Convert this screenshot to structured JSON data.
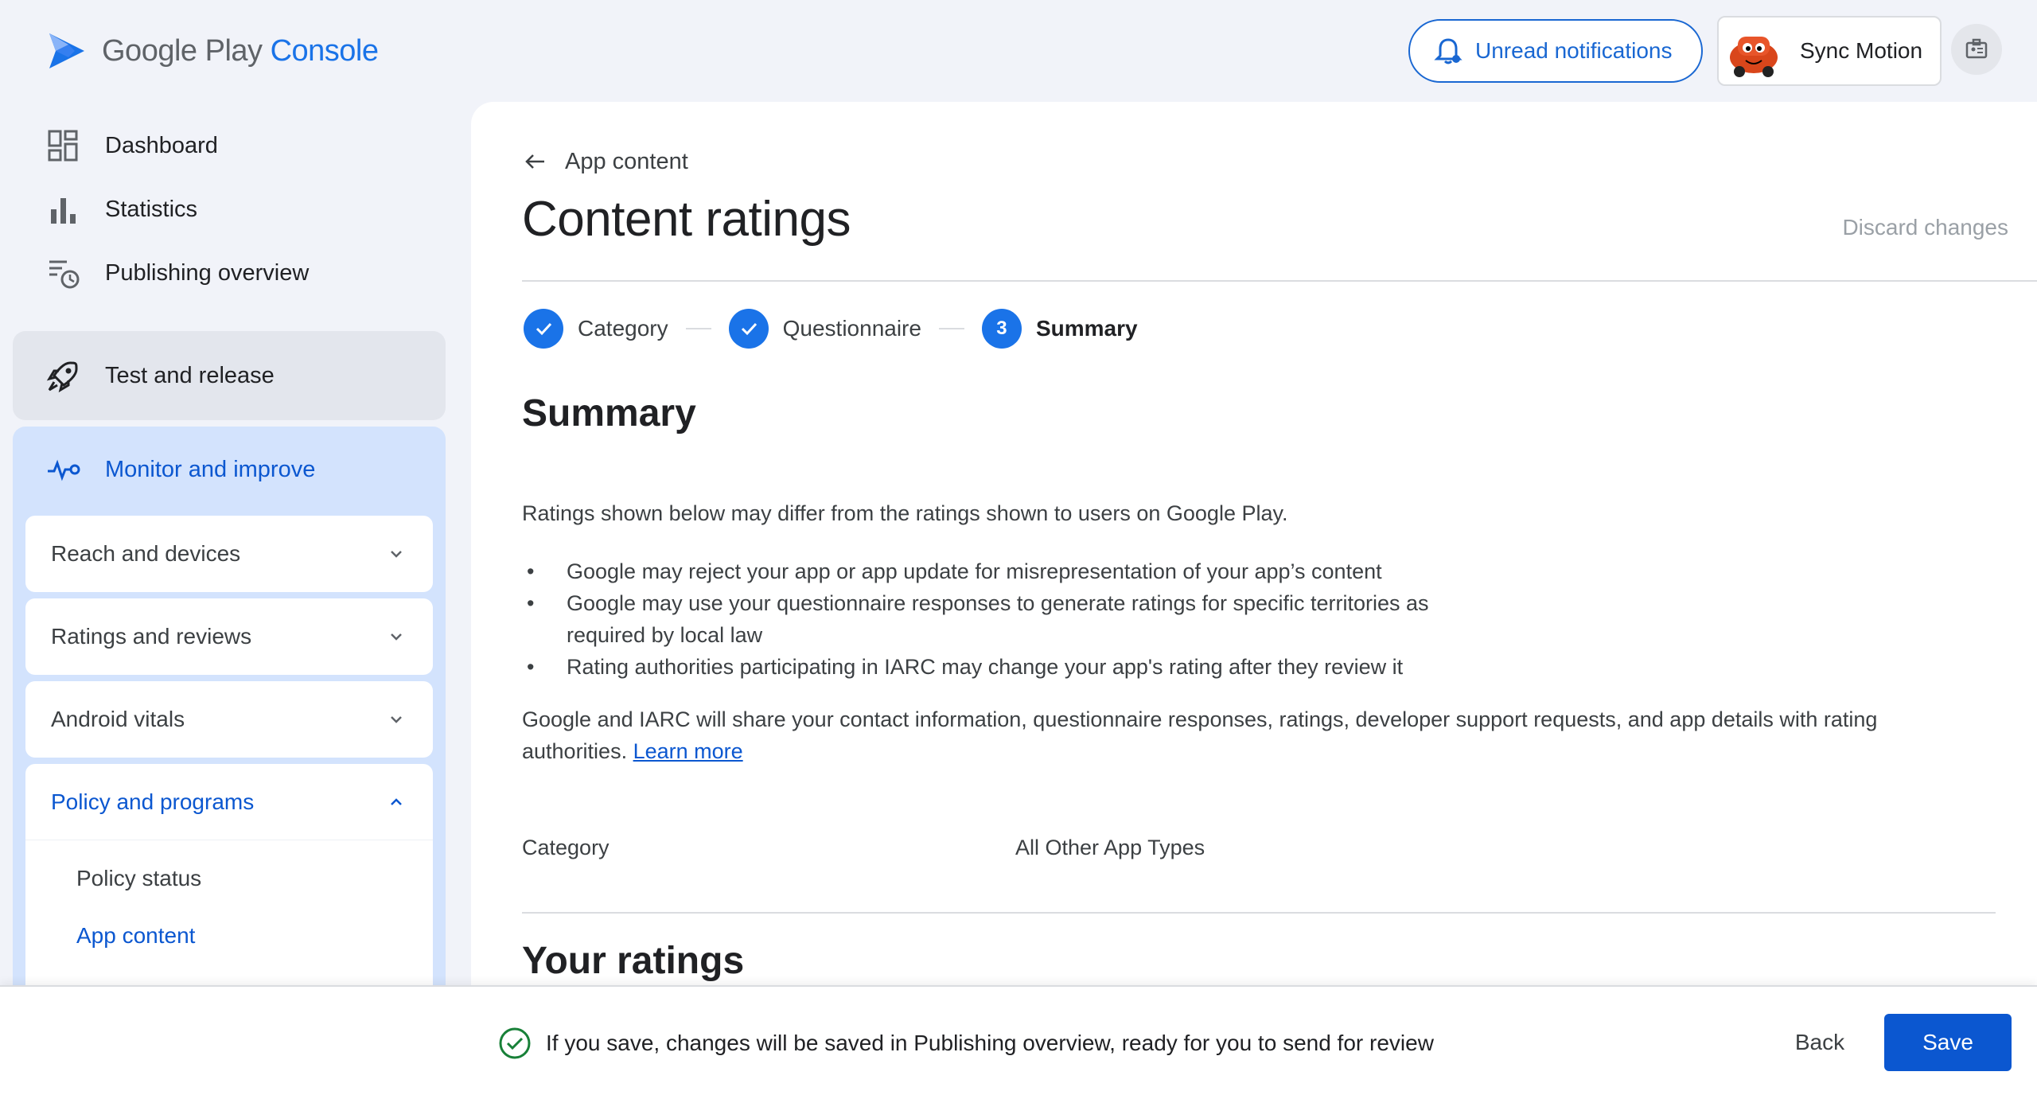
{
  "header": {
    "logo_google_play": "Google Play",
    "logo_console": "Console",
    "notifications_label": "Unread notifications",
    "account_name": "Sync Motion"
  },
  "sidebar": {
    "items": [
      {
        "label": "Dashboard",
        "icon": "dashboard-icon"
      },
      {
        "label": "Statistics",
        "icon": "bar-chart-icon"
      },
      {
        "label": "Publishing overview",
        "icon": "publishing-overview-icon"
      }
    ],
    "test_and_release": "Test and release",
    "monitor_and_improve": "Monitor and improve",
    "groups": [
      {
        "label": "Reach and devices",
        "expanded": false
      },
      {
        "label": "Ratings and reviews",
        "expanded": false
      },
      {
        "label": "Android vitals",
        "expanded": false
      }
    ],
    "policy_group": {
      "label": "Policy and programs",
      "expanded": true,
      "sub_items": [
        {
          "label": "Policy status",
          "active": false
        },
        {
          "label": "App content",
          "active": true
        }
      ]
    }
  },
  "main": {
    "back_label": "App content",
    "title": "Content ratings",
    "discard_label": "Discard changes",
    "steps": [
      {
        "label": "Category",
        "state": "done"
      },
      {
        "label": "Questionnaire",
        "state": "done"
      },
      {
        "label": "Summary",
        "state": "current",
        "number": "3"
      }
    ],
    "summary_heading": "Summary",
    "intro": "Ratings shown below may differ from the ratings shown to users on Google Play.",
    "bullets": [
      "Google may reject your app or app update for misrepresentation of your app’s content",
      "Google may use your questionnaire responses to generate ratings for specific territories as required by local law",
      "Rating authorities participating in IARC may change your app's rating after they review it"
    ],
    "share_text": "Google and IARC will share your contact information, questionnaire responses, ratings, developer support requests, and app details with rating authorities.",
    "learn_more": "Learn more",
    "category_label": "Category",
    "category_value": "All Other App Types",
    "ratings_heading": "Your ratings"
  },
  "bottom_bar": {
    "message": "If you save, changes will be saved in Publishing overview, ready for you to send for review",
    "back_label": "Back",
    "save_label": "Save"
  },
  "colors": {
    "accent": "#0b57d0",
    "brand_blue": "#1a73e8",
    "sidebar_active_bg": "#d3e3fd",
    "success_green": "#188038"
  }
}
